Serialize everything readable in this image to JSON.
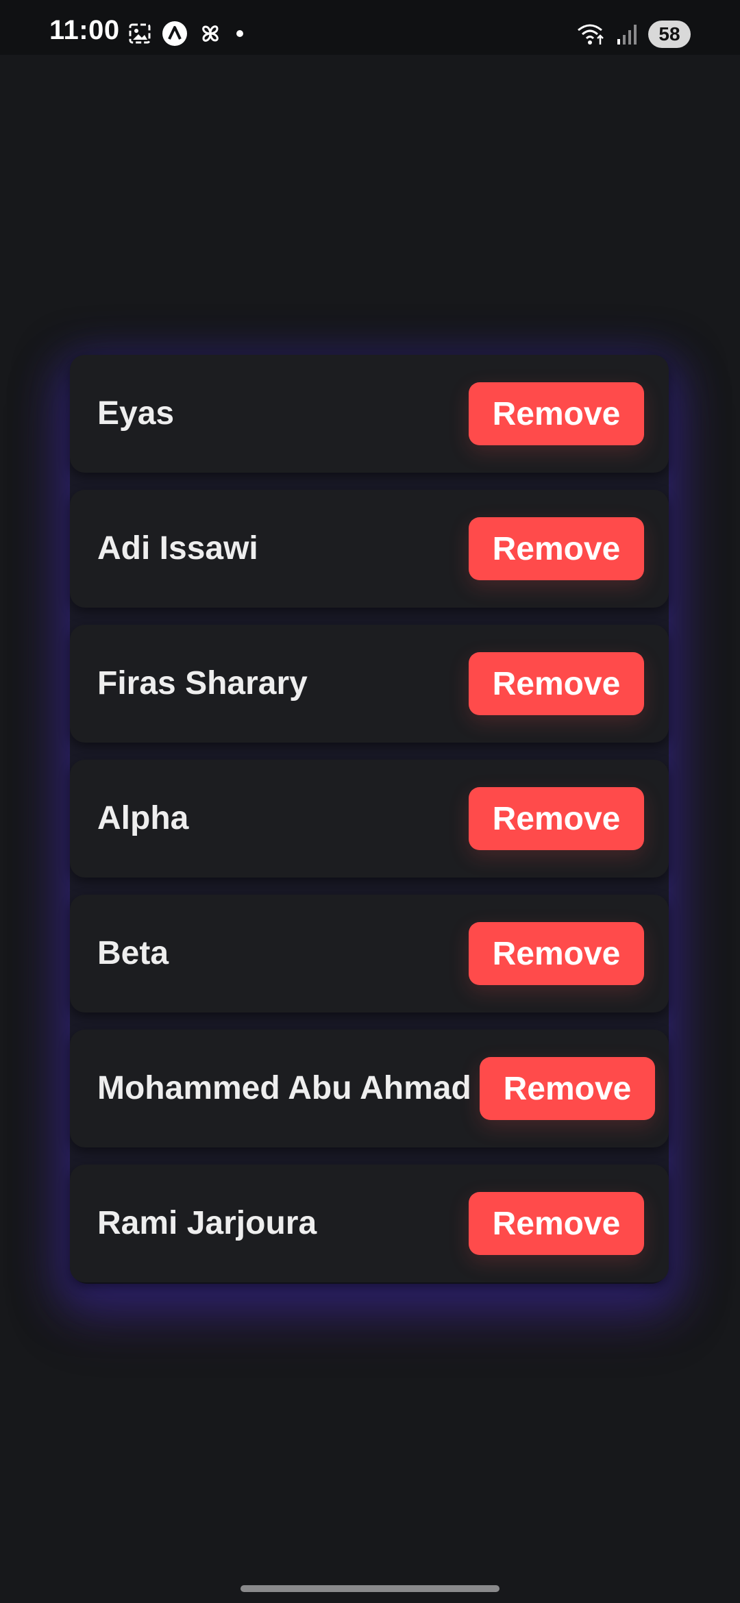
{
  "status_bar": {
    "time": "11:00",
    "battery": "58",
    "left_icons": [
      "screenshot-icon",
      "app-a-icon",
      "pinwheel-icon",
      "notification-dot-icon"
    ],
    "right_icons": [
      "wifi-icon",
      "signal-icon"
    ]
  },
  "list": {
    "items": [
      {
        "name": "Eyas",
        "button": "Remove"
      },
      {
        "name": "Adi Issawi",
        "button": "Remove"
      },
      {
        "name": "Firas Sharary",
        "button": "Remove"
      },
      {
        "name": "Alpha",
        "button": "Remove"
      },
      {
        "name": "Beta",
        "button": "Remove"
      },
      {
        "name": "Mohammed Abu Ahmad",
        "button": "Remove"
      },
      {
        "name": "Rami Jarjoura",
        "button": "Remove"
      }
    ]
  },
  "colors": {
    "background": "#17181b",
    "row": "#1c1d20",
    "remove_button": "#ff4b4b",
    "glow": "#30268c"
  }
}
